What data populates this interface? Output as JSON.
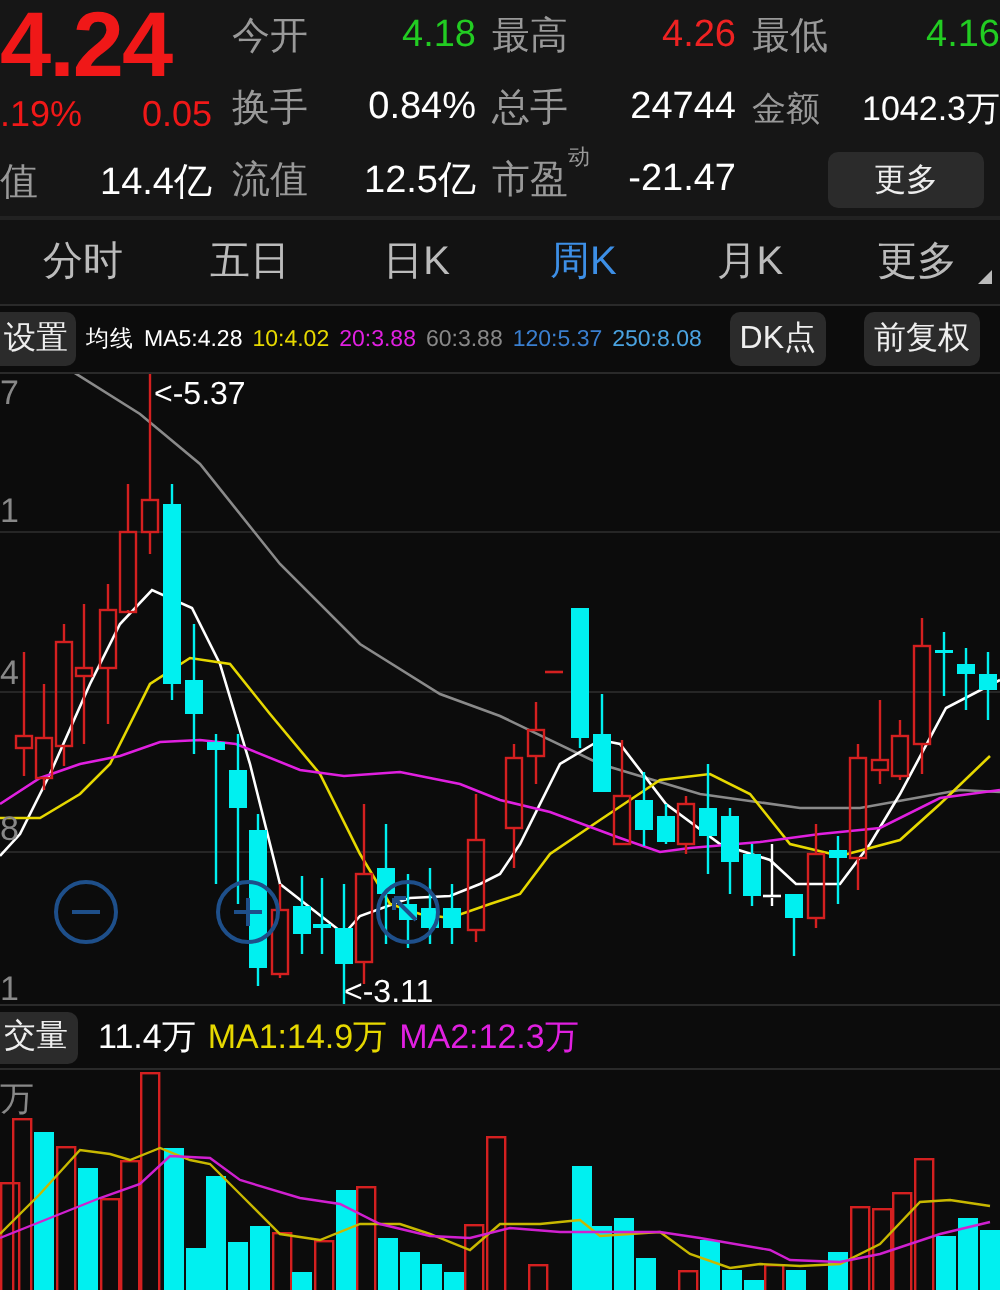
{
  "quote": {
    "price": "4.24",
    "change_percent": ".19%",
    "change": "0.05",
    "total_value_label": "值",
    "total_value": "14.4亿"
  },
  "stats": [
    {
      "label": "今开",
      "value": "4.18",
      "color": "#22cc22"
    },
    {
      "label": "最高",
      "value": "4.26",
      "color": "#ee2222"
    },
    {
      "label": "最低",
      "value": "4.16",
      "color": "#22cc22"
    },
    {
      "label": "换手",
      "value": "0.84%",
      "color": "#ffffff"
    },
    {
      "label": "总手",
      "value": "24744",
      "color": "#ffffff"
    },
    {
      "label": "金额",
      "value": "1042.3万",
      "color": "#ffffff"
    },
    {
      "label": "流值",
      "value": "12.5亿",
      "color": "#ffffff"
    },
    {
      "label": "市盈",
      "superscript": "动",
      "value": "-21.47",
      "color": "#ffffff"
    }
  ],
  "more_button": "更多",
  "tabs": [
    {
      "label": "分时",
      "selected": false
    },
    {
      "label": "五日",
      "selected": false
    },
    {
      "label": "日K",
      "selected": false
    },
    {
      "label": "周K",
      "selected": true
    },
    {
      "label": "月K",
      "selected": false
    },
    {
      "label": "更多",
      "selected": false,
      "menu": true
    }
  ],
  "toolbar": {
    "settings_button": "设置",
    "ma_label": "均线",
    "ma_legend": [
      {
        "text": "MA5:4.28",
        "color": "#ffffff"
      },
      {
        "text": "10:4.02",
        "color": "#e6d800"
      },
      {
        "text": "20:3.88",
        "color": "#e020e0"
      },
      {
        "text": "60:3.88",
        "color": "#888888"
      },
      {
        "text": "120:5.37",
        "color": "#3a7fd0"
      },
      {
        "text": "250:8.08",
        "color": "#4aa3e0"
      }
    ],
    "buttons": [
      "DK点",
      "前复权"
    ]
  },
  "price_chart": {
    "axis_labels": [
      "7",
      "1",
      "4",
      "8",
      "1"
    ],
    "annotations": [
      "<-5.37",
      "<-3.11"
    ]
  },
  "volume": {
    "label": "交量",
    "legend": [
      {
        "text": "11.4万",
        "color": "#ffffff"
      },
      {
        "text": "MA1:14.9万",
        "color": "#e6d800"
      },
      {
        "text": "MA2:12.3万",
        "color": "#e020e0"
      }
    ],
    "axis_label": "万"
  }
}
